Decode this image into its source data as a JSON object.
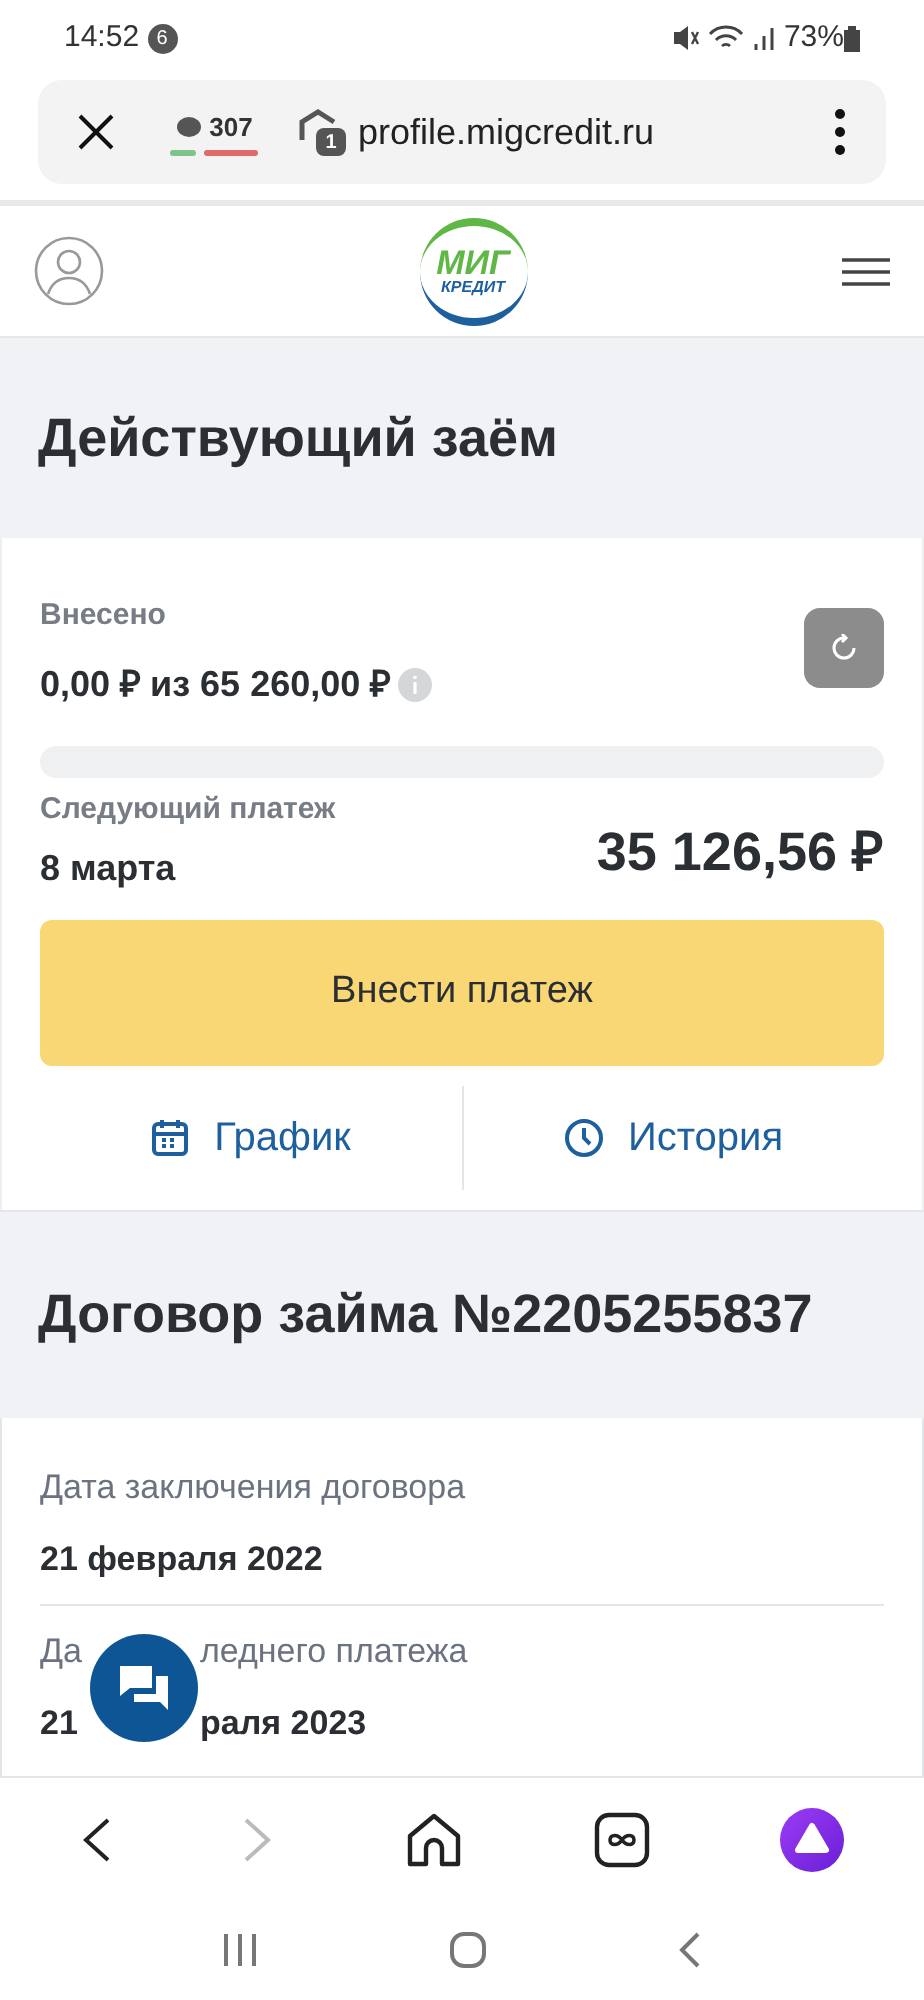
{
  "status_bar": {
    "time": "14:52",
    "notification_count": "6",
    "battery": "73%"
  },
  "browser": {
    "tab_count": "307",
    "url": "profile.migcredit.ru",
    "site_badge": "1"
  },
  "logo": {
    "line_1": "МИГ",
    "line_2": "КРЕДИТ"
  },
  "loan": {
    "title": "Действующий заём",
    "paid_label": "Внесено",
    "paid_value": "0,00 ₽ из 65 260,00 ₽",
    "level": 0,
    "next_label": "Следующий платеж",
    "next_date": "8 марта",
    "next_amount": "35 126,56 ₽",
    "pay_button": "Внести платеж",
    "links": [
      {
        "label": "График",
        "kind": "calendar"
      },
      {
        "label": "История",
        "kind": "clock"
      }
    ]
  },
  "contract": {
    "title": "Договор займа №2205255837",
    "fields": [
      {
        "label": "Дата заключения договора",
        "value": "21 февраля 2022"
      },
      {
        "label_parts": [
          "Да",
          "леднего платежа"
        ],
        "value_parts": [
          "21",
          "раля 2023"
        ]
      }
    ]
  }
}
